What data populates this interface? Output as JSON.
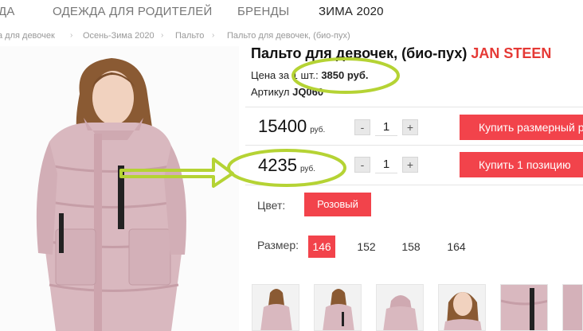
{
  "nav": {
    "items": [
      {
        "label": "ДА"
      },
      {
        "label": "ОДЕЖДА ДЛЯ РОДИТЕЛЕЙ"
      },
      {
        "label": "БРЕНДЫ"
      },
      {
        "label": "ЗИМА 2020"
      }
    ]
  },
  "breadcrumb": [
    "а для девочек",
    "Осень-Зима 2020",
    "Пальто",
    "Пальто для девочек, (био-пух)"
  ],
  "product": {
    "title": "Пальто для девочек, (био-пух)",
    "brand": "JAN STEEN",
    "unit_price_label": "Цена за 1 шт.:",
    "unit_price_value": "3850 руб.",
    "article_label": "Артикул",
    "article_value": "JQ060"
  },
  "offers": [
    {
      "price": "15400",
      "currency": "руб.",
      "qty": "1",
      "buy_label": "Купить размерный ряд"
    },
    {
      "price": "4235",
      "currency": "руб.",
      "qty": "1",
      "buy_label": "Купить 1 позицию"
    }
  ],
  "qty_controls": {
    "minus": "-",
    "plus": "+"
  },
  "color": {
    "label": "Цвет:",
    "value": "Розовый"
  },
  "sizes": {
    "label": "Размер:",
    "options": [
      "146",
      "152",
      "158",
      "164"
    ],
    "selected": "146"
  },
  "colors": {
    "accent": "#f2434b",
    "annotation": "#b5d334",
    "coat": "#d9b8bf"
  }
}
